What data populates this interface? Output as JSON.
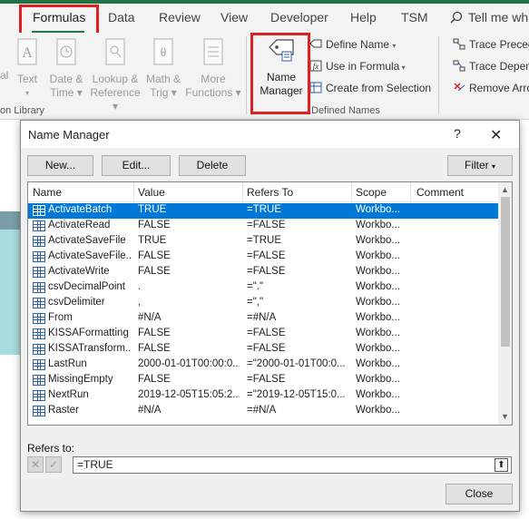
{
  "ribbon": {
    "tabs": [
      {
        "label": "Formulas",
        "active": true
      },
      {
        "label": "Data"
      },
      {
        "label": "Review"
      },
      {
        "label": "View"
      },
      {
        "label": "Developer"
      },
      {
        "label": "Help"
      },
      {
        "label": "TSM"
      }
    ],
    "tell_me": "Tell me wh",
    "buttons": {
      "logical": "al",
      "text": "Text",
      "date_time_1": "Date &",
      "date_time_2": "Time",
      "lookup_1": "Lookup &",
      "lookup_2": "Reference",
      "math_1": "Math &",
      "math_2": "Trig",
      "more_1": "More",
      "more_2": "Functions",
      "name_manager_1": "Name",
      "name_manager_2": "Manager"
    },
    "defined_names": {
      "define_name": "Define Name",
      "use_in_formula": "Use in Formula",
      "create_from_selection": "Create from Selection",
      "group_label": "Defined Names"
    },
    "auditing": {
      "trace_precedents": "Trace Preced",
      "trace_dependents": "Trace Depen",
      "remove_arrows": "Remove Arro"
    },
    "function_library_label": "on Library",
    "accent_color": "#217346",
    "highlight_color": "#e02020"
  },
  "dialog": {
    "title": "Name Manager",
    "help": "?",
    "close_glyph": "✕",
    "buttons": {
      "new": "New...",
      "edit": "Edit...",
      "delete": "Delete",
      "filter": "Filter",
      "close": "Close"
    },
    "columns": [
      "Name",
      "Value",
      "Refers To",
      "Scope",
      "Comment"
    ],
    "rows": [
      {
        "name": "ActivateBatch",
        "value": "TRUE",
        "refers": "=TRUE",
        "scope": "Workbo...",
        "selected": true
      },
      {
        "name": "ActivateRead",
        "value": "FALSE",
        "refers": "=FALSE",
        "scope": "Workbo..."
      },
      {
        "name": "ActivateSaveFile",
        "value": "TRUE",
        "refers": "=TRUE",
        "scope": "Workbo..."
      },
      {
        "name": "ActivateSaveFile...",
        "value": "FALSE",
        "refers": "=FALSE",
        "scope": "Workbo..."
      },
      {
        "name": "ActivateWrite",
        "value": "FALSE",
        "refers": "=FALSE",
        "scope": "Workbo..."
      },
      {
        "name": "csvDecimalPoint",
        "value": ".",
        "refers": "=\".\"",
        "scope": "Workbo..."
      },
      {
        "name": "csvDelimiter",
        "value": ",",
        "refers": "=\",\"",
        "scope": "Workbo..."
      },
      {
        "name": "From",
        "value": "#N/A",
        "refers": "=#N/A",
        "scope": "Workbo..."
      },
      {
        "name": "KISSAFormatting",
        "value": "FALSE",
        "refers": "=FALSE",
        "scope": "Workbo..."
      },
      {
        "name": "KISSATransform...",
        "value": "FALSE",
        "refers": "=FALSE",
        "scope": "Workbo..."
      },
      {
        "name": "LastRun",
        "value": "2000-01-01T00:00:0...",
        "refers": "=\"2000-01-01T00:0...",
        "scope": "Workbo..."
      },
      {
        "name": "MissingEmpty",
        "value": "FALSE",
        "refers": "=FALSE",
        "scope": "Workbo..."
      },
      {
        "name": "NextRun",
        "value": "2019-12-05T15:05:2...",
        "refers": "=\"2019-12-05T15:0...",
        "scope": "Workbo..."
      },
      {
        "name": "Raster",
        "value": "#N/A",
        "refers": "=#N/A",
        "scope": "Workbo..."
      }
    ],
    "refers_to_label": "Refers to:",
    "refers_to_value": "=TRUE"
  }
}
